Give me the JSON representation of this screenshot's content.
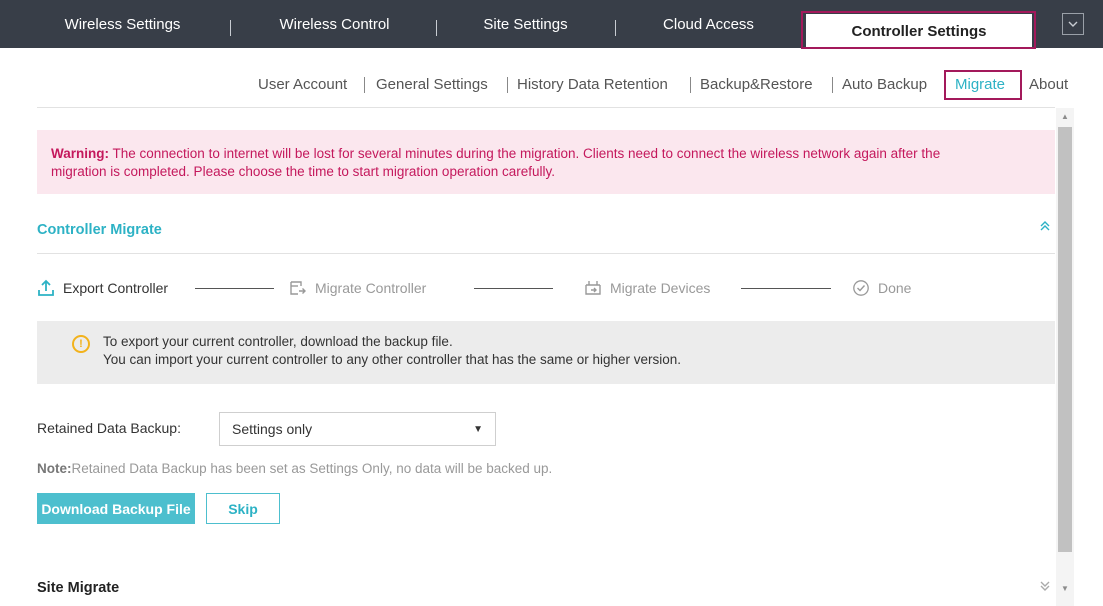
{
  "top_tabs": [
    {
      "label": "Wireless Settings"
    },
    {
      "label": "Wireless Control"
    },
    {
      "label": "Site Settings"
    },
    {
      "label": "Cloud Access"
    },
    {
      "label": "Controller Settings"
    }
  ],
  "active_top_tab": "Controller Settings",
  "top_menu_icon": "chevron-down-icon",
  "sub_nav": [
    {
      "label": "User Account"
    },
    {
      "label": "General Settings"
    },
    {
      "label": "History Data Retention"
    },
    {
      "label": "Backup&Restore"
    },
    {
      "label": "Auto Backup"
    },
    {
      "label": "Migrate"
    },
    {
      "label": "About"
    }
  ],
  "active_sub_nav": "Migrate",
  "warning": {
    "prefix": "Warning:",
    "line1": " The connection to internet will be lost for several minutes during the migration. Clients need to connect the wireless network again after the",
    "line2": "migration is completed. Please choose the time to start migration operation carefully."
  },
  "controller_migrate": {
    "title": "Controller Migrate",
    "collapse_icon": "double-chevron-up-icon",
    "steps": [
      {
        "label": "Export Controller",
        "icon": "export-icon",
        "state": "current"
      },
      {
        "label": "Migrate Controller",
        "icon": "migrate-controller-icon",
        "state": "pending"
      },
      {
        "label": "Migrate Devices",
        "icon": "migrate-devices-icon",
        "state": "pending"
      },
      {
        "label": "Done",
        "icon": "check-circle-icon",
        "state": "pending"
      }
    ],
    "info": {
      "icon": "info-icon",
      "line1": "To export your current controller, download the backup file.",
      "line2": "You can import your current controller to any other controller that has the same or higher version."
    },
    "retained_label": "Retained Data Backup:",
    "retained_value": "Settings only",
    "note_prefix": "Note:",
    "note_text": "Retained Data Backup has been set as Settings Only, no data will be backed up.",
    "download_button": "Download Backup File",
    "skip_button": "Skip"
  },
  "site_migrate": {
    "title": "Site Migrate",
    "expand_icon": "double-chevron-down-icon"
  },
  "colors": {
    "topbar": "#383e48",
    "accent": "#2db2c5",
    "highlight": "#a3195b",
    "warning_bg": "#fbe7ee",
    "warning_text": "#c4185c"
  }
}
